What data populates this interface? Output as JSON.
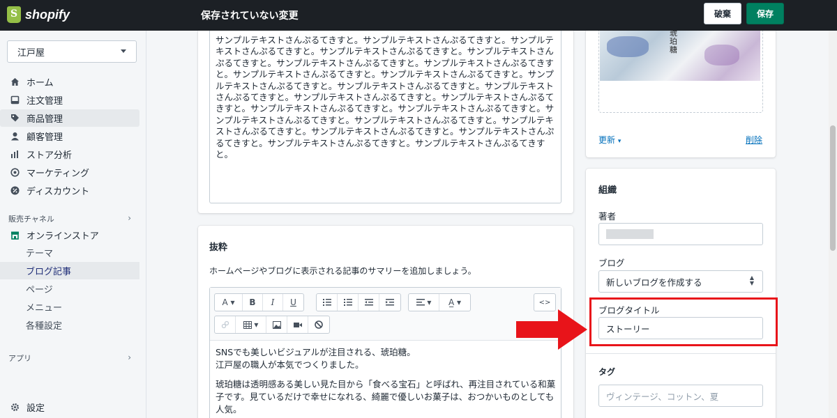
{
  "topbar": {
    "brand": "shopify",
    "unsaved_title": "保存されていない変更",
    "discard_label": "破棄",
    "save_label": "保存"
  },
  "sidebar": {
    "store_name": "江戸屋",
    "nav": [
      {
        "label": "ホーム",
        "icon": "home-icon"
      },
      {
        "label": "注文管理",
        "icon": "orders-icon"
      },
      {
        "label": "商品管理",
        "icon": "tag-icon"
      },
      {
        "label": "顧客管理",
        "icon": "person-icon"
      },
      {
        "label": "ストア分析",
        "icon": "bar-chart-icon"
      },
      {
        "label": "マーケティング",
        "icon": "target-icon"
      },
      {
        "label": "ディスカウント",
        "icon": "discount-icon"
      }
    ],
    "sales_channels_label": "販売チャネル",
    "online_store_label": "オンラインストア",
    "sub_items": [
      "テーマ",
      "ブログ記事",
      "ページ",
      "メニュー",
      "各種設定"
    ],
    "apps_label": "アプリ",
    "settings_label": "設定"
  },
  "content": {
    "body_text": "サンプルテキストさんぷるてきすと。サンプルテキストさんぷるてきすと。サンプルテキストさんぷるてきすと。サンプルテキストさんぷるてきすと。サンプルテキストさんぷるてきすと。サンプルテキストさんぷるてきすと。サンプルテキストさんぷるてきすと。サンプルテキストさんぷるてきすと。サンプルテキストさんぷるてきすと。サンプルテキストさんぷるてきすと。サンプルテキストさんぷるてきすと。サンプルテキストさんぷるてきすと。サンプルテキストさんぷるてきすと。サンプルテキストさんぷるてきすと。サンプルテキストさんぷるてきすと。サンプルテキストさんぷるてきすと。サンプルテキストさんぷるてきすと。サンプルテキストさんぷるてきすと。サンプルテキストさんぷるてきすと。サンプルテキストさんぷるてきすと。サンプルテキストさんぷるてきすと。サンプルテキストさんぷるてきすと。サンプルテキストさんぷるてきすと。",
    "excerpt_title": "抜粋",
    "excerpt_desc": "ホームページやブログに表示される記事のサマリーを追加しましょう。",
    "editor_line1": "SNSでも美しいビジュアルが注目される、琥珀糖。",
    "editor_line2": "江戸屋の職人が本気でつくりました。",
    "editor_para2": "琥珀糖は透明感ある美しい見た目から「食べる宝石」と呼ばれ、再注目されている和菓子です。見ているだけで幸せになれる、綺麗で優しいお菓子は、おつかいものとしても人気。"
  },
  "right": {
    "image_text": "琥珀糖",
    "update_label": "更新",
    "delete_label": "削除",
    "org_title": "組織",
    "author_label": "著者",
    "blog_label": "ブログ",
    "blog_value": "新しいブログを作成する",
    "blog_title_label": "ブログタイトル",
    "blog_title_value": "ストーリー",
    "tags_label": "タグ",
    "tags_placeholder": "ヴィンテージ、コットン、夏"
  },
  "colors": {
    "accent": "#008060",
    "highlight_box": "#e8141a",
    "arrow": "#e8141a",
    "link": "#006fbb"
  }
}
